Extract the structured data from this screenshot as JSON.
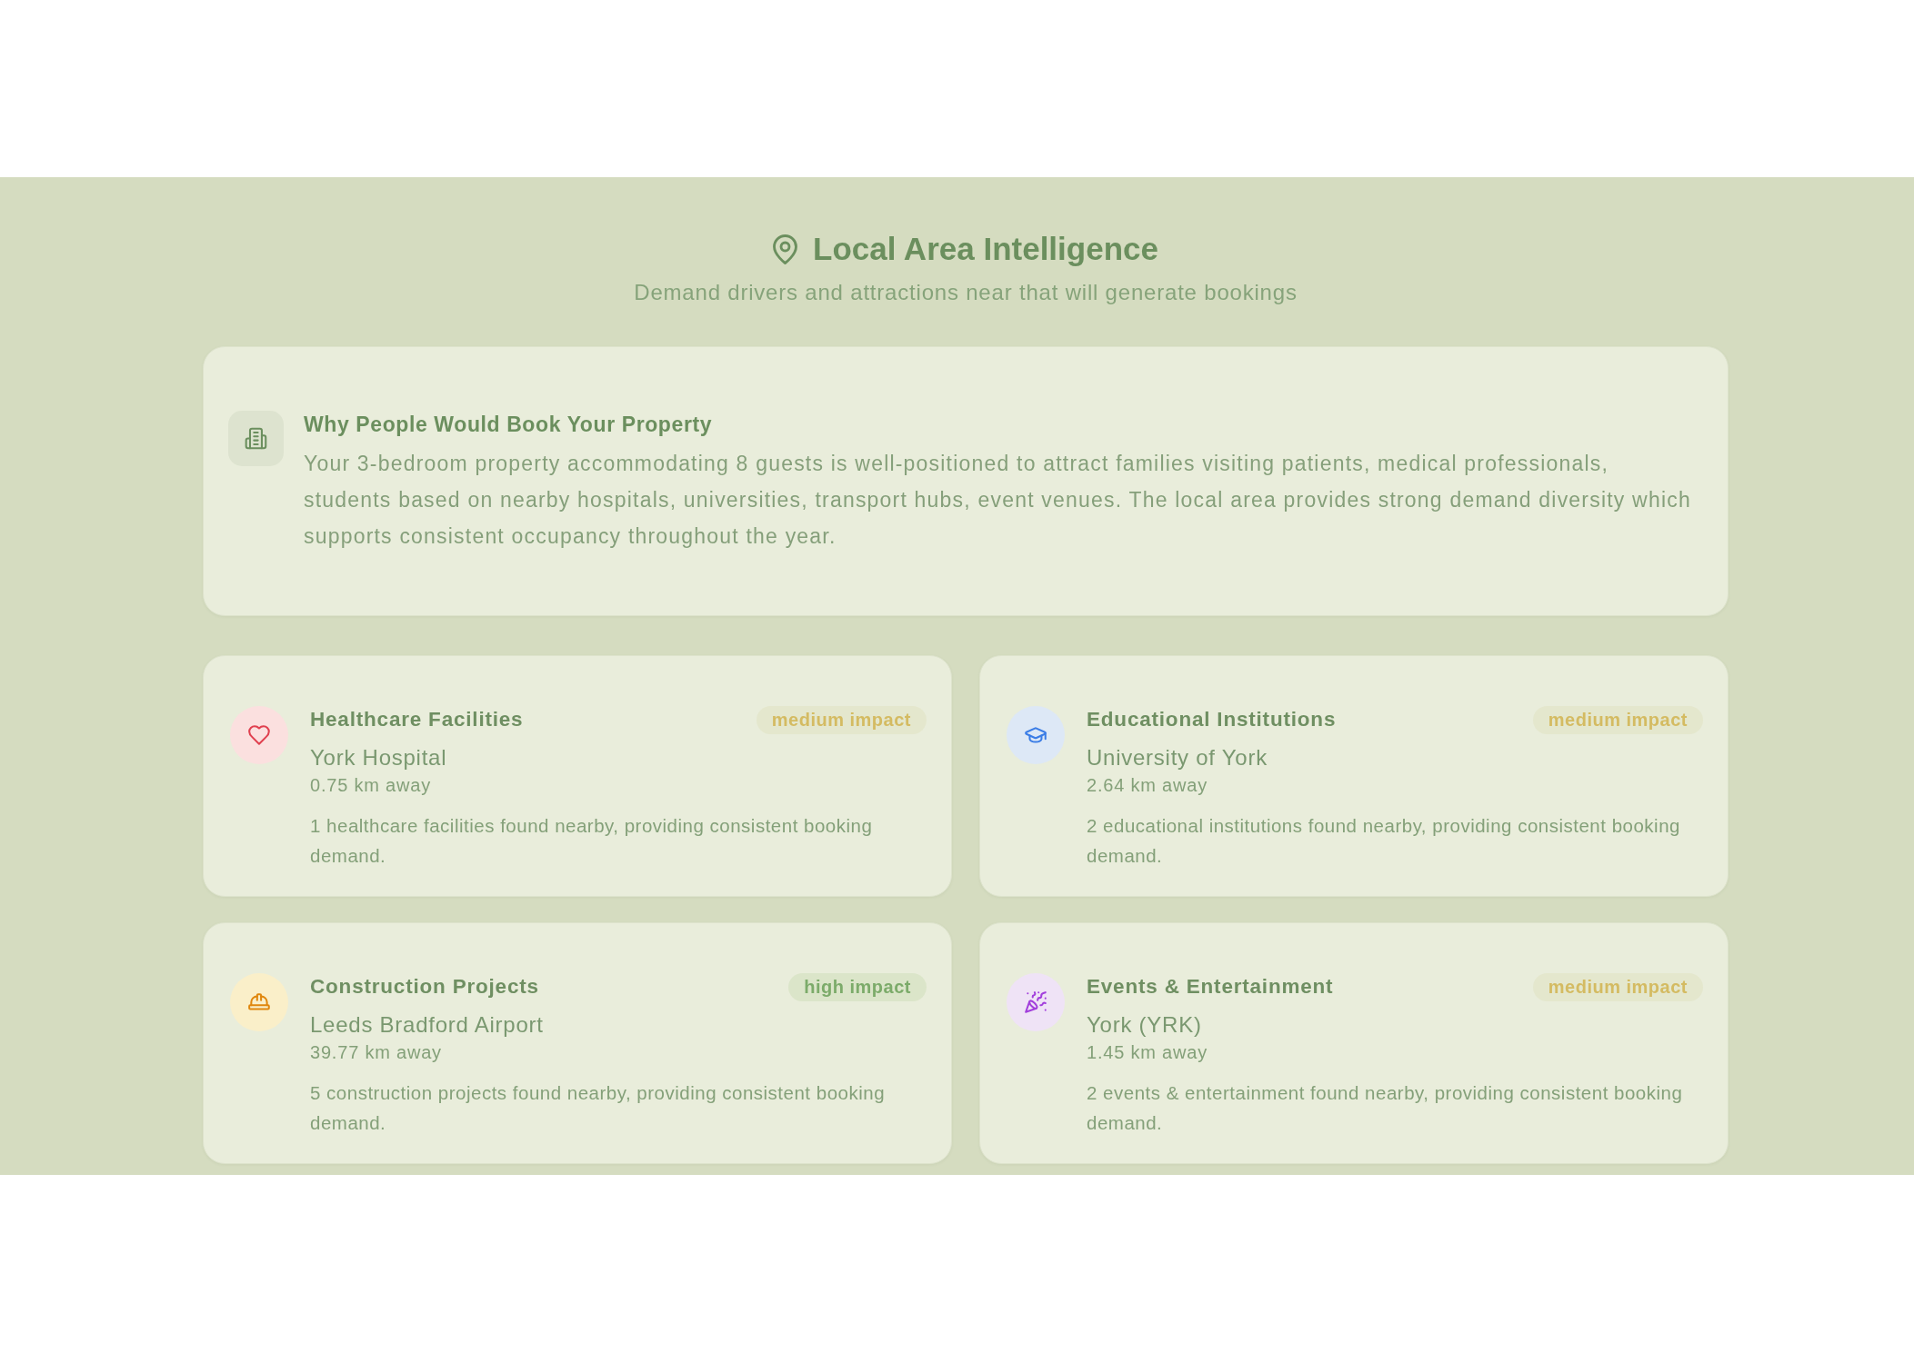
{
  "header": {
    "title": "Local Area Intelligence",
    "subtitle": "Demand drivers and attractions near that will generate bookings"
  },
  "summary": {
    "title": "Why People Would Book Your Property",
    "text": "Your 3-bedroom property accommodating 8 guests is well-positioned to attract families visiting patients, medical professionals, students based on nearby hospitals, universities, transport hubs, event venues. The local area provides strong demand diversity which supports consistent occupancy throughout the year."
  },
  "drivers": [
    {
      "kind": "healthcare",
      "title": "Healthcare Facilities",
      "impact": {
        "kind": "medium",
        "label": "medium impact"
      },
      "place": "York Hospital",
      "distance": "0.75 km away",
      "description": "1 healthcare facilities found nearby, providing consistent booking demand."
    },
    {
      "kind": "education",
      "title": "Educational Institutions",
      "impact": {
        "kind": "medium",
        "label": "medium impact"
      },
      "place": "University of York",
      "distance": "2.64 km away",
      "description": "2 educational institutions found nearby, providing consistent booking demand."
    },
    {
      "kind": "construction",
      "title": "Construction Projects",
      "impact": {
        "kind": "high",
        "label": "high impact"
      },
      "place": "Leeds Bradford Airport",
      "distance": "39.77 km away",
      "description": "5 construction projects found nearby, providing consistent booking demand."
    },
    {
      "kind": "events",
      "title": "Events & Entertainment",
      "impact": {
        "kind": "medium",
        "label": "medium impact"
      },
      "place": "York (YRK)",
      "distance": "1.45 km away",
      "description": "2 events & entertainment found nearby, providing consistent booking demand."
    }
  ]
}
